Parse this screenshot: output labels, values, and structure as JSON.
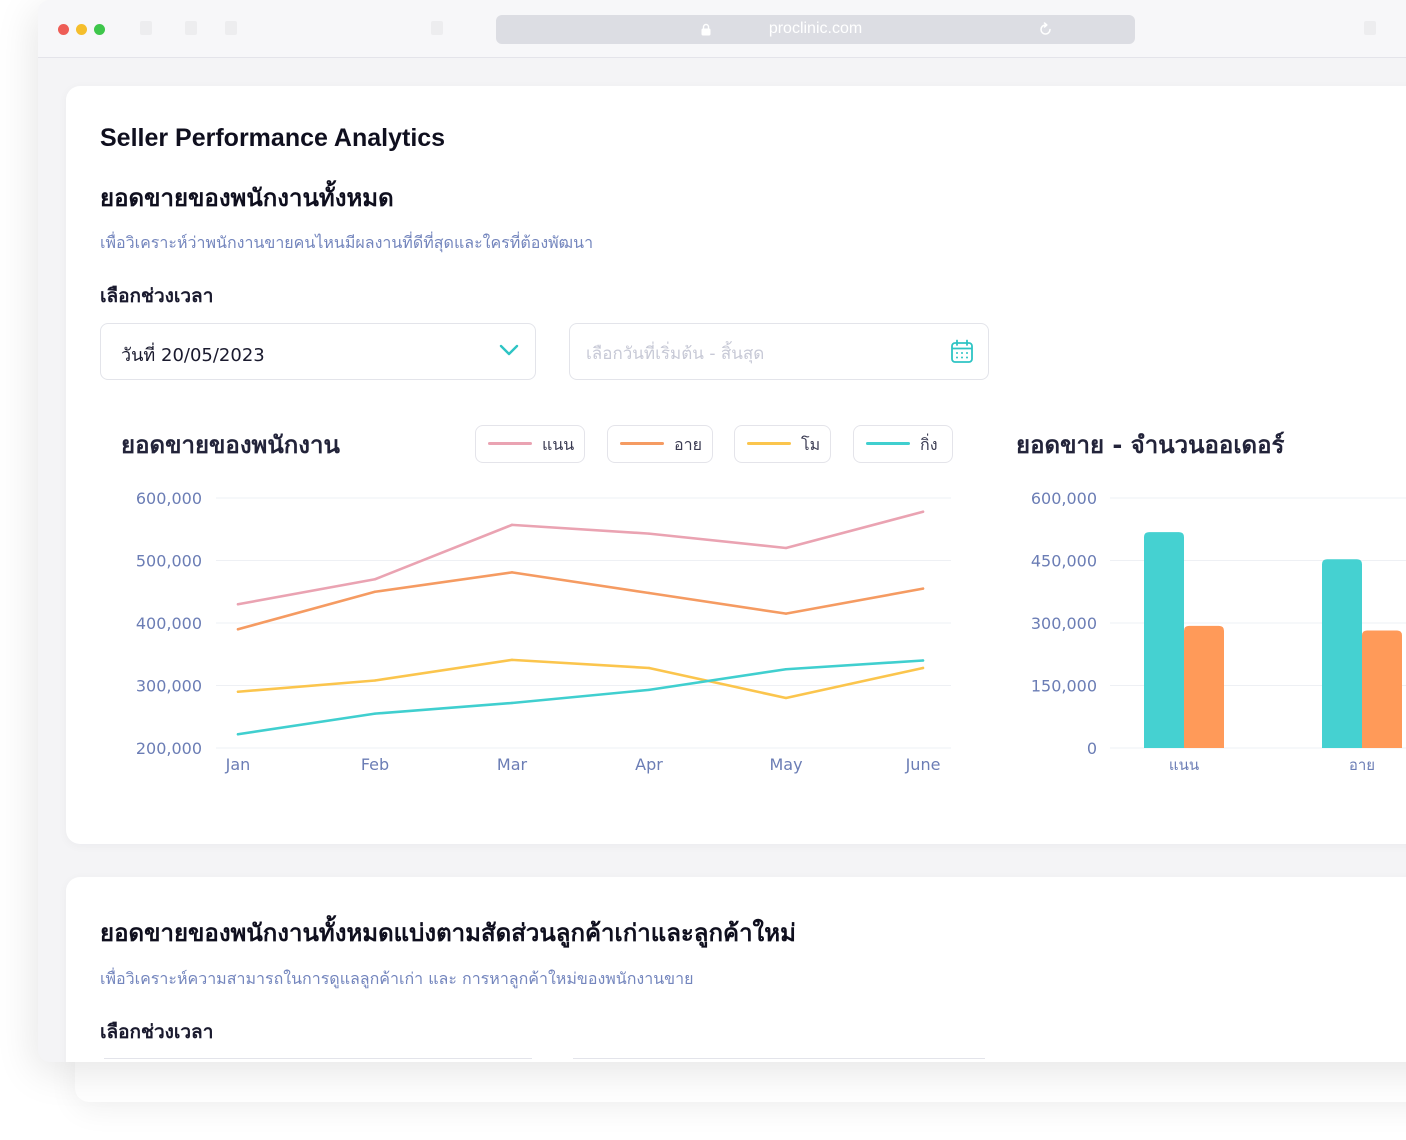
{
  "browser": {
    "url": "proclinic.com"
  },
  "section1": {
    "app_title": "Seller Performance Analytics",
    "title": "ยอดขายของพนักงานทั้งหมด",
    "subtitle": "เพื่อวิเคราะห์ว่าพนักงานขายคนไหนมีผลงานที่ดีที่สุดและใครที่ต้องพัฒนา",
    "period_label": "เลือกช่วงเวลา",
    "period_select_value": "วันที่ 20/05/2023",
    "date_range_placeholder": "เลือกวันที่เริ่มต้น - สิ้นสุด"
  },
  "line_chart_title": "ยอดขายของพนักงาน",
  "bar_chart_title": "ยอดขาย - จำนวนออเดอร์",
  "section2": {
    "title": "ยอดขายของพนักงานทั้งหมดแบ่งตามสัดส่วนลูกค้าเก่าและลูกค้าใหม่",
    "subtitle": "เพื่อวิเคราะห์ความสามารถในการดูแลลูกค้าเก่า และ การหาลูกค้าใหม่ของพนักงานขาย",
    "period_label": "เลือกช่วงเวลา"
  },
  "icons": {
    "lock": "lock-icon",
    "reload": "reload-icon",
    "chevron": "chevron-down-icon",
    "calendar": "calendar-icon"
  },
  "chart_data": [
    {
      "type": "line",
      "categories": [
        "Jan",
        "Feb",
        "Mar",
        "Apr",
        "May",
        "June"
      ],
      "ylim": [
        200000,
        600000
      ],
      "yticks": [
        "600,000",
        "500,000",
        "400,000",
        "300,000",
        "200,000"
      ],
      "ytick_values": [
        600000,
        500000,
        400000,
        300000,
        200000
      ],
      "grid": true,
      "legend_position": "top",
      "series": [
        {
          "name": "แนน",
          "color": "#eaa3b2",
          "values": [
            430000,
            470000,
            557000,
            543000,
            520000,
            578000
          ]
        },
        {
          "name": "อาย",
          "color": "#f59b62",
          "values": [
            390000,
            450000,
            481000,
            448000,
            415000,
            455000
          ]
        },
        {
          "name": "โม",
          "color": "#fbc54d",
          "values": [
            290000,
            308000,
            341000,
            328000,
            280000,
            328000
          ]
        },
        {
          "name": "กิ่ง",
          "color": "#40cfcf",
          "values": [
            222000,
            255000,
            272000,
            293000,
            326000,
            340000
          ]
        }
      ]
    },
    {
      "type": "bar",
      "categories": [
        "แนน",
        "อาย"
      ],
      "ylim": [
        0,
        600000
      ],
      "yticks": [
        "600,000",
        "450,000",
        "300,000",
        "150,000",
        "0"
      ],
      "ytick_values": [
        600000,
        450000,
        300000,
        150000,
        0
      ],
      "grid": true,
      "series": [
        {
          "color": "#45d1d1",
          "values": [
            518000,
            453000
          ]
        },
        {
          "color": "#ff9a59",
          "values": [
            293000,
            282000
          ]
        }
      ]
    }
  ]
}
